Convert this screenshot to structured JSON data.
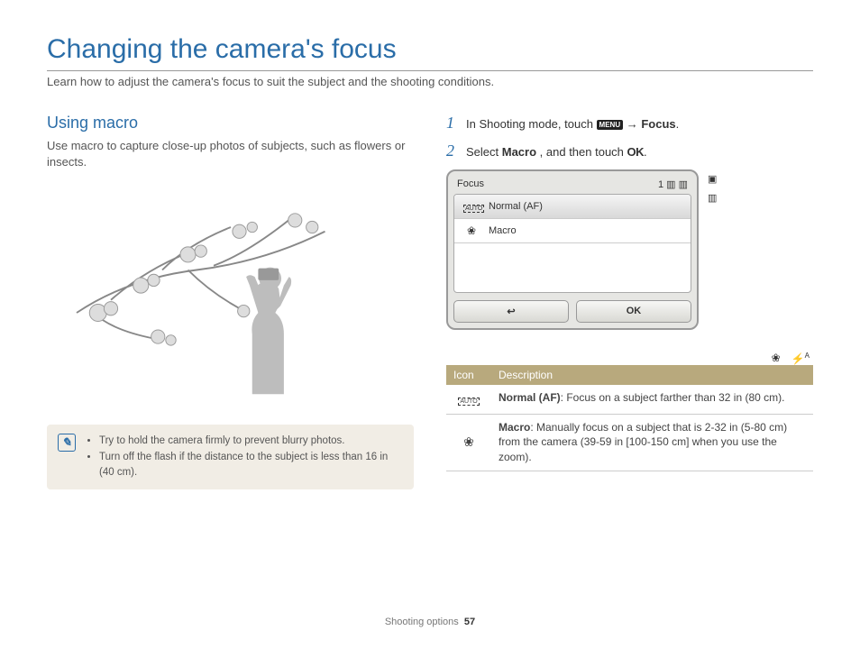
{
  "title": "Changing the camera's focus",
  "subtitle": "Learn how to adjust the camera's focus to suit the subject and the shooting conditions.",
  "left": {
    "heading": "Using macro",
    "desc": "Use macro to capture close-up photos of subjects, such as flowers or insects.",
    "tips": [
      "Try to hold the camera firmly to prevent blurry photos.",
      "Turn off the flash if the distance to the subject is less than 16 in (40 cm)."
    ]
  },
  "steps": {
    "s1_a": "In Shooting mode, touch ",
    "s1_menu": "MENU",
    "s1_arrow": " → ",
    "s1_b": "Focus",
    "s1_c": ".",
    "s2_a": "Select ",
    "s2_b": "Macro",
    "s2_c": ", and then touch ",
    "s2_ok": "OK",
    "s2_d": "."
  },
  "screen": {
    "title": "Focus",
    "count": "1",
    "options": [
      {
        "icon": "AUTO",
        "label": "Normal (AF)",
        "selected": true
      },
      {
        "icon": "❀",
        "label": "Macro",
        "selected": false
      }
    ],
    "back": "↩",
    "ok": "OK"
  },
  "table": {
    "h1": "Icon",
    "h2": "Description",
    "rows": [
      {
        "icon": "AUTO",
        "bold": "Normal (AF)",
        "text": ": Focus on a subject farther than 32 in (80 cm)."
      },
      {
        "icon": "❀",
        "bold": "Macro",
        "text": ": Manually focus on a subject that is 2-32 in (5-80 cm) from the camera (39-59 in [100-150 cm] when you use the zoom)."
      }
    ]
  },
  "footer": {
    "section": "Shooting options",
    "page": "57"
  }
}
